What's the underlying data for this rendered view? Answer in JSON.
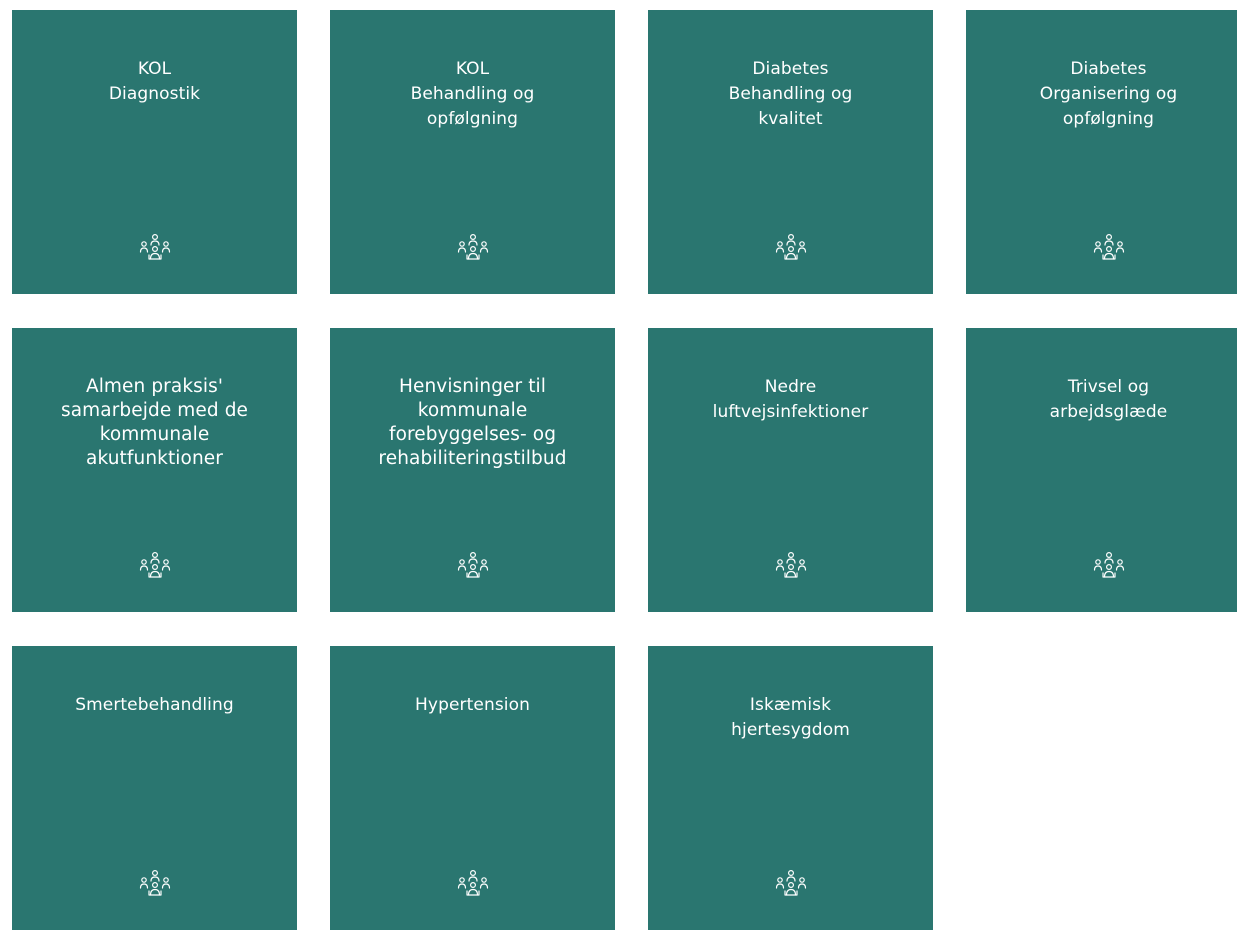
{
  "tiles": [
    {
      "label": "KOL\nDiagnostik",
      "icon": "people-group-icon"
    },
    {
      "label": "KOL\nBehandling og\nopfølgning",
      "icon": "people-group-icon"
    },
    {
      "label": "Diabetes\nBehandling og\nkvalitet",
      "icon": "people-group-icon"
    },
    {
      "label": "Diabetes\nOrganisering og\nopfølgning",
      "icon": "people-group-icon"
    },
    {
      "label": "Almen praksis'\nsamarbejde med de\nkommunale\nakutfunktioner",
      "icon": "people-group-icon"
    },
    {
      "label": "Henvisninger til\nkommunale\nforebyggelses- og\nrehabiliteringstilbud",
      "icon": "people-group-icon"
    },
    {
      "label": "Nedre\nluftvejsinfektioner",
      "icon": "people-group-icon"
    },
    {
      "label": "Trivsel og\narbejdsglæde",
      "icon": "people-group-icon"
    },
    {
      "label": "Smertebehandling",
      "icon": "people-group-icon"
    },
    {
      "label": "Hypertension",
      "icon": "people-group-icon"
    },
    {
      "label": "Iskæmisk\nhjertesygdom",
      "icon": "people-group-icon"
    }
  ],
  "colors": {
    "tile_background": "#2a7670",
    "tile_text": "#ffffff",
    "page_background": "#ffffff"
  }
}
